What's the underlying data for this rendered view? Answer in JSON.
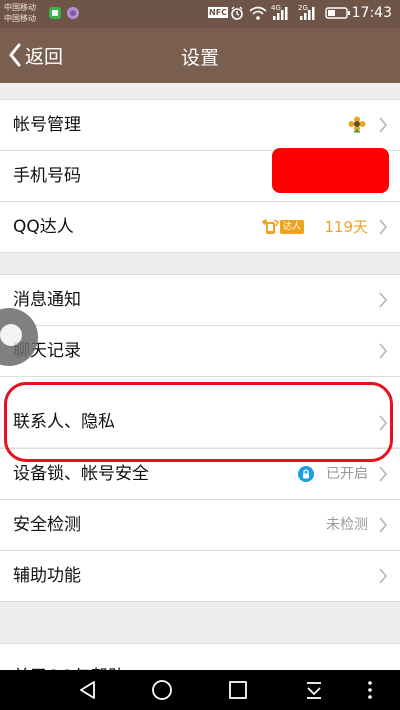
{
  "status_bar": {
    "carrier_1": "中国移动",
    "carrier_2": "中国移动",
    "nfc": "NFC",
    "net_4g": "4G",
    "net_2g": "2G",
    "time": "17:43"
  },
  "header": {
    "back_label": "返回",
    "title": "设置"
  },
  "settings": {
    "account_management": "帐号管理",
    "phone_number": "手机号码",
    "qq_expert": "QQ达人",
    "qq_badge": "达人",
    "qq_days": "119天",
    "message_notification": "消息通知",
    "chat_history": "聊天记录",
    "contacts_privacy": "联系人、隐私",
    "device_lock": "设备锁、帐号安全",
    "device_lock_status": "已开启",
    "security_check": "安全检测",
    "security_check_status": "未检测",
    "accessibility": "辅助功能",
    "about": "关于QQ与帮助"
  },
  "colors": {
    "title_bar": "#7a5e50",
    "status_bar": "#6e5548",
    "highlight_border": "#e8101a",
    "redaction": "#ff0000",
    "qq_accent": "#f0a321",
    "lock_icon": "#1aa0e0"
  },
  "icons": {
    "back": "chevron-left-icon",
    "avatar": "flower-avatar-icon",
    "lock": "lock-icon",
    "row_arrow": "chevron-right-icon"
  }
}
